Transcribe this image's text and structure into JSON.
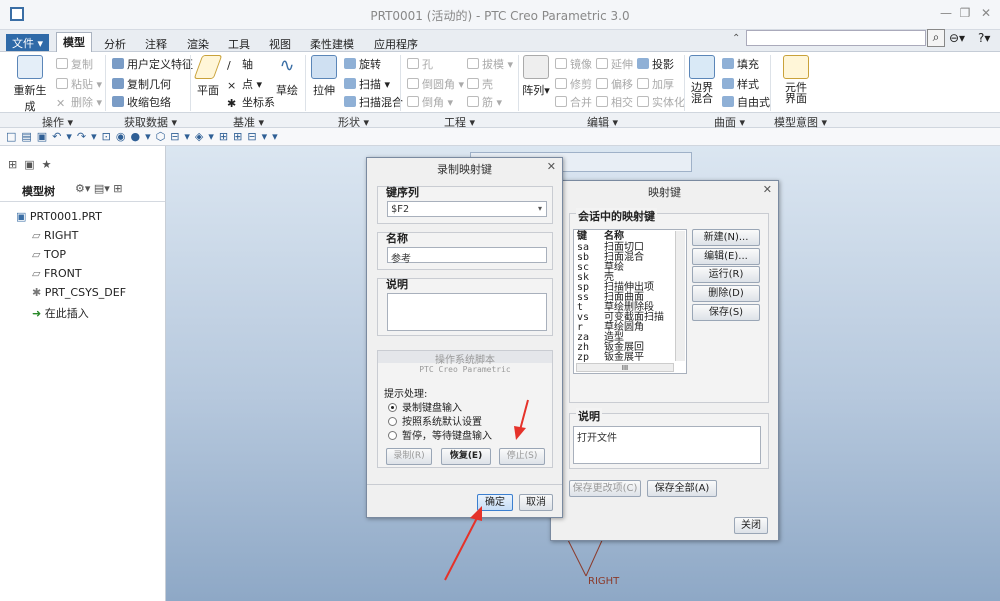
{
  "window": {
    "title": "PRT0001 (活动的) - PTC Creo Parametric 3.0"
  },
  "tabs": [
    "文件",
    "模型",
    "分析",
    "注释",
    "渲染",
    "工具",
    "视图",
    "柔性建模",
    "应用程序"
  ],
  "ribbon": {
    "op": {
      "regen": "重新生成",
      "copy": "复制",
      "paste": "粘贴",
      "delete": "删除"
    },
    "getdata": {
      "udf": "用户定义特征",
      "copygeom": "复制几何",
      "shrinkwrap": "收缩包络"
    },
    "datum": {
      "plane": "平面",
      "axis": "轴",
      "point": "点",
      "csys": "坐标系",
      "sketch": "草绘"
    },
    "shape": {
      "extrude": "拉伸",
      "revolve": "旋转",
      "sweep": "扫描",
      "swept_blend": "扫描混合"
    },
    "eng": {
      "hole": "孔",
      "round": "倒圆角",
      "chamfer": "倒角",
      "draft": "拔模",
      "shell": "壳",
      "rib": "筋"
    },
    "edit": {
      "pattern": "阵列",
      "mirror": "镜像",
      "trim": "修剪",
      "merge": "合并",
      "extend": "延伸",
      "offset": "偏移",
      "intersect": "相交",
      "project": "投影",
      "thicken": "加厚",
      "solidify": "实体化"
    },
    "surface": {
      "boundary_blend": "边界混合",
      "fill": "填充",
      "style": "样式",
      "freestyle": "自由式"
    },
    "intent": {
      "component_interface": "元件界面"
    }
  },
  "groups": [
    "操作",
    "获取数据",
    "基准",
    "形状",
    "工程",
    "编辑",
    "曲面",
    "模型意图"
  ],
  "tree": {
    "title": "模型树",
    "items": [
      "PRT0001.PRT",
      "RIGHT",
      "TOP",
      "FRONT",
      "PRT_CSYS_DEF",
      "在此插入"
    ]
  },
  "record_dialog": {
    "title": "录制映射键",
    "key_seq_label": "键序列",
    "key_seq_value": "$F2",
    "name_label": "名称",
    "name_value": "参考",
    "desc_label": "说明",
    "os_script": "操作系统脚本",
    "ptc_label": "PTC Creo Parametric",
    "prompt_label": "提示处理:",
    "options": [
      "录制键盘输入",
      "按照系统默认设置",
      "暂停，等待键盘输入"
    ],
    "btn_record": "录制(R)",
    "btn_resume": "恢复(E)",
    "btn_stop": "停止(S)",
    "btn_ok": "确定",
    "btn_cancel": "取消"
  },
  "mapkey_dialog": {
    "title": "映射键",
    "section_label": "会话中的映射键",
    "col_key": "键",
    "col_name": "名称",
    "rows": [
      [
        "sa",
        "扫面切口"
      ],
      [
        "sb",
        "扫面混合"
      ],
      [
        "sc",
        "草绘"
      ],
      [
        "sk",
        "壳"
      ],
      [
        "sp",
        "扫描伸出项"
      ],
      [
        "ss",
        "扫面曲面"
      ],
      [
        "t",
        "草绘删除段"
      ],
      [
        "vs",
        "可变截面扫描"
      ],
      [
        "r",
        "草绘圆角"
      ],
      [
        "za",
        "造型"
      ],
      [
        "zh",
        "钣金展回"
      ],
      [
        "zp",
        "钣金展平"
      ]
    ],
    "btn_new": "新建(N)...",
    "btn_edit": "编辑(E)...",
    "btn_run": "运行(R)",
    "btn_delete": "删除(D)",
    "btn_save": "保存(S)",
    "desc_label": "说明",
    "desc_value": "打开文件",
    "btn_save_changed": "保存更改项(C)",
    "btn_save_all": "保存全部(A)",
    "btn_close": "关闭"
  },
  "canvas": {
    "right_label": "RIGHT"
  }
}
